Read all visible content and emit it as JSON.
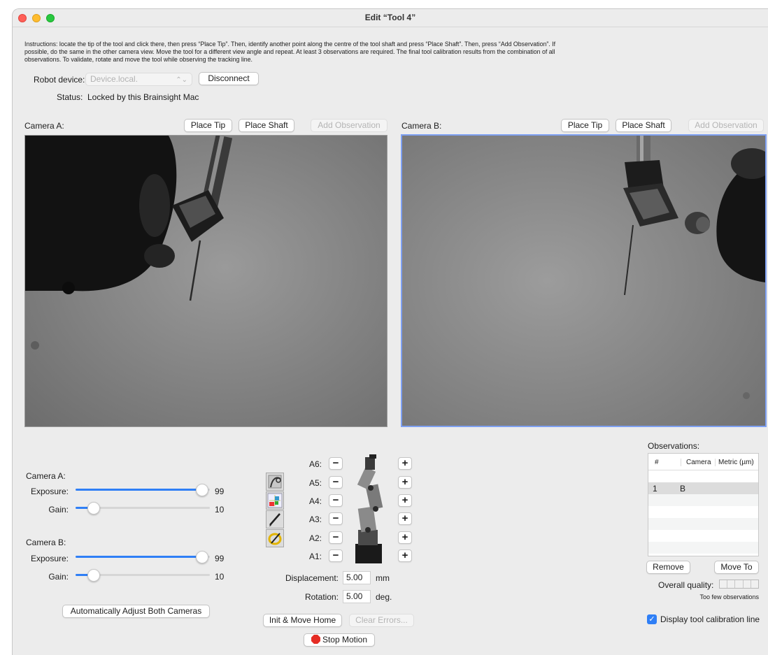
{
  "window": {
    "title": "Edit “Tool 4”"
  },
  "instructions": "Instructions: locate the tip of the tool and click there, then press “Place Tip”. Then, identify another point along the centre of the tool shaft and press “Place Shaft”. Then, press “Add Observation”. If possible, do the same in the other camera view. Move the tool for a different view angle and repeat. At least 3 observations are required. The final tool calibration results from the combination of all observations. To validate, rotate and move the tool while observing the tracking line.",
  "robot": {
    "device_label": "Robot device:",
    "device_value": "Device.local.",
    "disconnect_label": "Disconnect",
    "status_label": "Status:",
    "status_value": "Locked by this Brainsight Mac"
  },
  "camera_a": {
    "label": "Camera A:",
    "place_tip": "Place Tip",
    "place_shaft": "Place Shaft",
    "add_observation": "Add Observation"
  },
  "camera_b": {
    "label": "Camera B:",
    "place_tip": "Place Tip",
    "place_shaft": "Place Shaft",
    "add_observation": "Add Observation"
  },
  "controls": {
    "camera_a": {
      "label": "Camera A:",
      "exposure_label": "Exposure:",
      "exposure_value": "99",
      "exposure_fraction": 0.99,
      "gain_label": "Gain:",
      "gain_value": "10",
      "gain_fraction": 0.1
    },
    "camera_b": {
      "label": "Camera B:",
      "exposure_label": "Exposure:",
      "exposure_value": "99",
      "exposure_fraction": 0.99,
      "gain_label": "Gain:",
      "gain_value": "10",
      "gain_fraction": 0.1
    },
    "auto_adjust_label": "Automatically Adjust Both Cameras"
  },
  "robot_arm": {
    "axes": [
      "A6:",
      "A5:",
      "A4:",
      "A3:",
      "A2:",
      "A1:"
    ],
    "minus": "−",
    "plus": "+",
    "displacement_label": "Displacement:",
    "displacement_value": "5.00",
    "displacement_unit": "mm",
    "rotation_label": "Rotation:",
    "rotation_value": "5.00",
    "rotation_unit": "deg.",
    "init_home_label": "Init & Move Home",
    "clear_errors_label": "Clear Errors...",
    "stop_motion_label": "Stop Motion"
  },
  "observations": {
    "title": "Observations:",
    "columns": [
      "#",
      "Camera",
      "Metric (µm)"
    ],
    "rows": [
      {
        "num": "1",
        "camera": "B",
        "metric": ""
      }
    ],
    "remove_label": "Remove",
    "move_to_label": "Move To",
    "quality_label": "Overall quality:",
    "quality_status": "Too few observations",
    "display_line_label": "Display tool calibration line",
    "display_line_checked": true
  },
  "colors": {
    "accent": "#2f7ff6",
    "selection_border": "#7ea0f2",
    "stop": "#e52c24"
  }
}
